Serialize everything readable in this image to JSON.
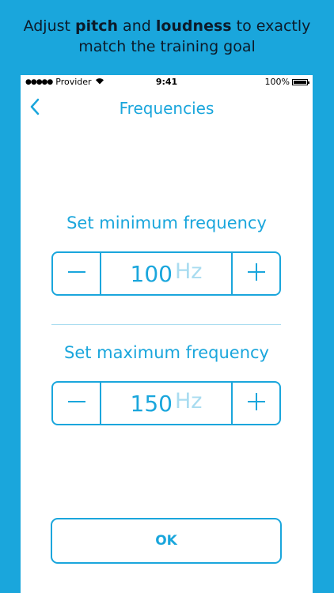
{
  "caption": {
    "text_before": "Adjust ",
    "pitch": "pitch",
    "and": " and ",
    "loudness": "loudness",
    "text_after": " to exactly",
    "line2": "match the training goal"
  },
  "status_bar": {
    "dots": "●●●●●",
    "carrier": "Provider",
    "time": "9:41",
    "battery": "100%"
  },
  "nav": {
    "back_icon": "chevron-left-icon",
    "title": "Frequencies"
  },
  "min_frequency": {
    "label": "Set minimum frequency",
    "value": "100",
    "unit": "Hz"
  },
  "max_frequency": {
    "label": "Set maximum frequency",
    "value": "150",
    "unit": "Hz"
  },
  "ok_label": "OK",
  "colors": {
    "background": "#1aa6dc",
    "accent": "#1aa6dc",
    "unit_light": "#a9dcf0",
    "screen": "#ffffff",
    "caption_text": "#0c1b2a"
  }
}
